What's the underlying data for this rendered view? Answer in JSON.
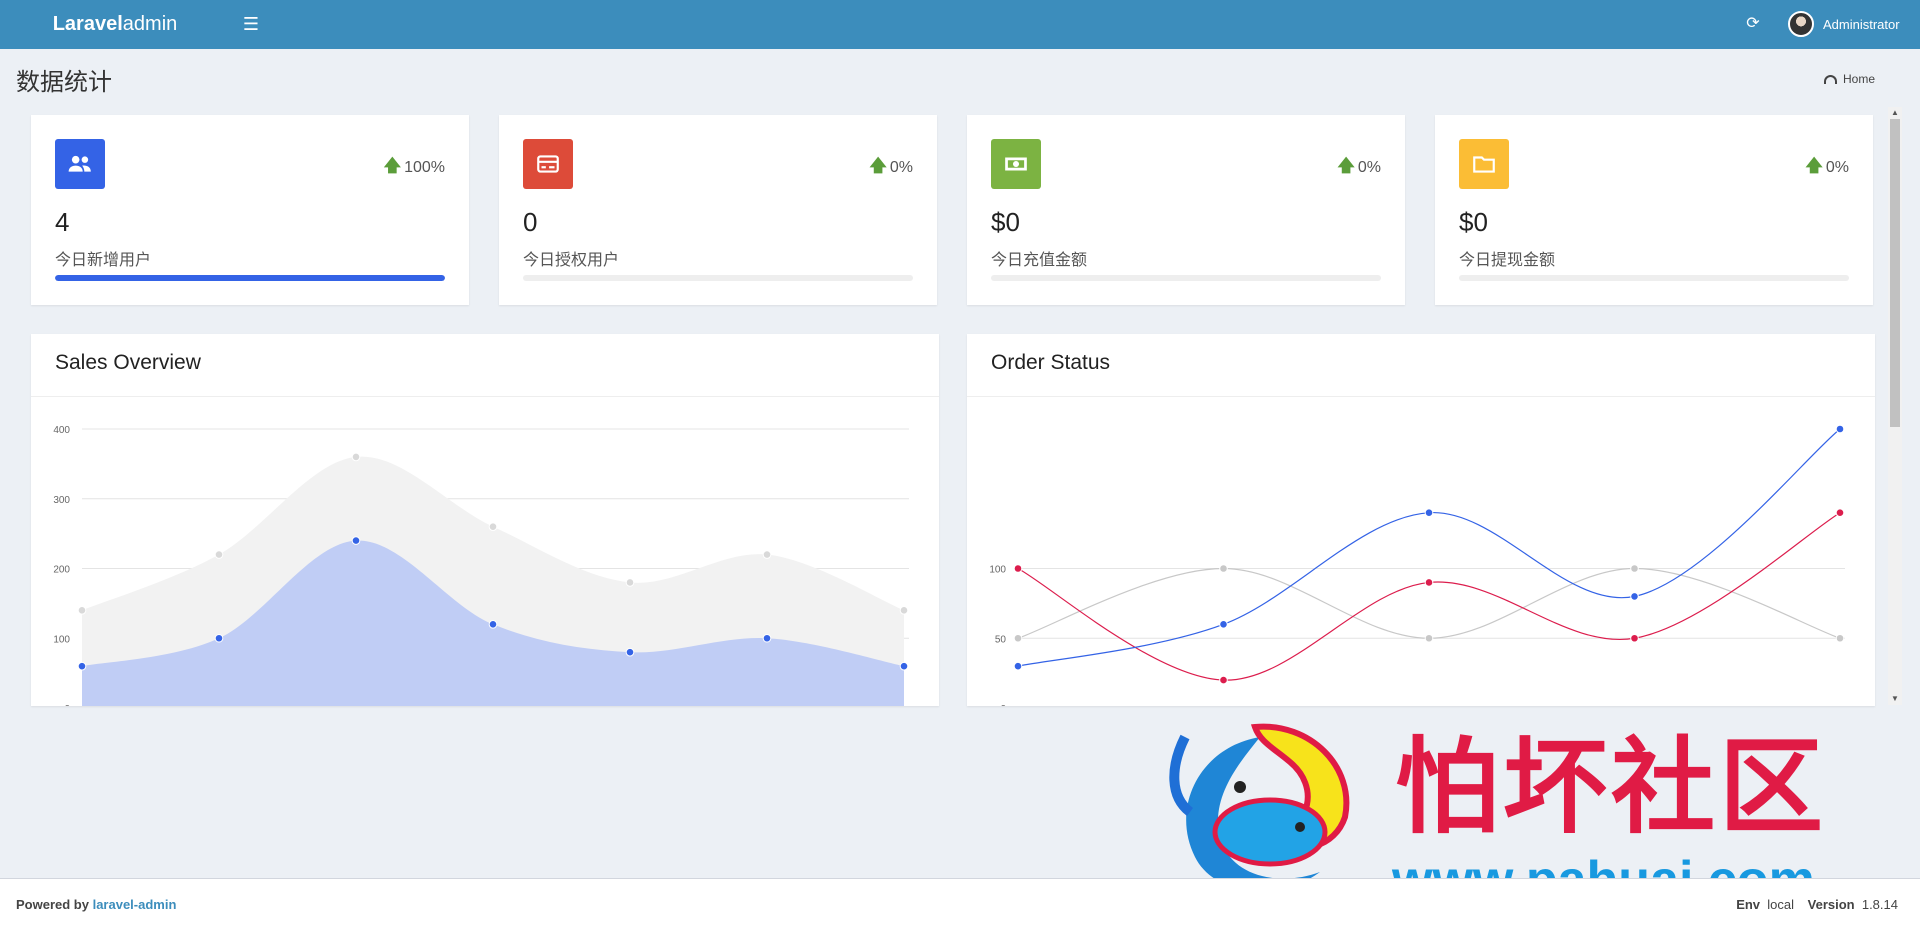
{
  "navbar": {
    "logo_bold": "Laravel",
    "logo_light": " admin",
    "toggle_icon": "☰",
    "refresh_icon": "⟳",
    "user_name": "Administrator"
  },
  "page": {
    "title": "数据统计",
    "breadcrumb_home": "Home"
  },
  "stats": [
    {
      "icon": "users-icon",
      "color": "#3463e6",
      "change": "100%",
      "value": "4",
      "label": "今日新增用户",
      "progress": 1.0
    },
    {
      "icon": "card-icon",
      "color": "#dd4b39",
      "change": "0%",
      "value": "0",
      "label": "今日授权用户",
      "progress": 0
    },
    {
      "icon": "money-icon",
      "color": "#7cb342",
      "change": "0%",
      "value": "$0",
      "label": "今日充值金额",
      "progress": 0
    },
    {
      "icon": "folder-icon",
      "color": "#fbbd35",
      "change": "0%",
      "value": "$0",
      "label": "今日提现金额",
      "progress": 0
    }
  ],
  "chart_data": [
    {
      "type": "area",
      "title": "Sales Overview",
      "yticks": [
        "400",
        "300",
        "200",
        "100",
        "0"
      ],
      "ylim": [
        0,
        400
      ],
      "grid": true,
      "series": [
        {
          "color": "#d9d9d9",
          "fill": "#f2f2f2",
          "values": [
            140,
            220,
            360,
            260,
            180,
            220,
            140
          ]
        },
        {
          "color": "#3463e6",
          "fill": "#c0cdf5",
          "values": [
            60,
            100,
            240,
            120,
            80,
            100,
            60
          ]
        }
      ]
    },
    {
      "type": "line",
      "title": "Order Status",
      "yticks": [
        "100",
        "50",
        "0"
      ],
      "ylim": [
        0,
        200
      ],
      "grid": true,
      "series": [
        {
          "color": "#c8c8c8",
          "values": [
            50,
            100,
            50,
            100,
            50
          ]
        },
        {
          "color": "#dc1d4d",
          "values": [
            100,
            20,
            90,
            50,
            140
          ]
        },
        {
          "color": "#3463e6",
          "values": [
            30,
            60,
            140,
            80,
            200
          ]
        }
      ]
    }
  ],
  "footer": {
    "powered_by": "Powered by ",
    "powered_link": "laravel-admin",
    "env_label": "Env",
    "env_value": "local",
    "version_label": "Version",
    "version_value": "1.8.14"
  },
  "watermark": {
    "title": "怕坏社区",
    "url": "www.pahuai.com"
  }
}
